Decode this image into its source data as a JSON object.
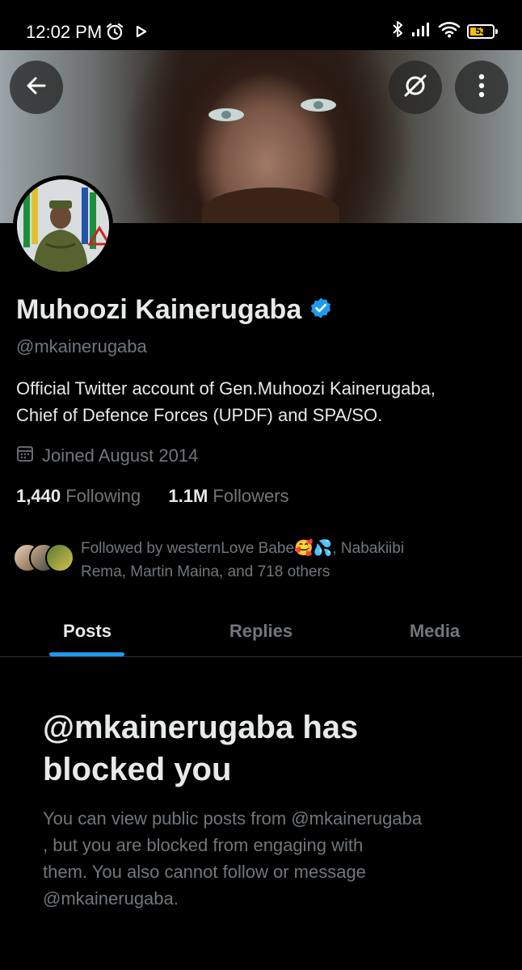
{
  "status_bar": {
    "time": "12:02 PM",
    "battery_level": "53",
    "icons": [
      "alarm-icon",
      "play-icon",
      "bluetooth-icon",
      "signal-icon",
      "wifi-icon",
      "battery-icon"
    ]
  },
  "header": {
    "back_icon": "arrow-left-icon",
    "grok_icon": "grok-icon",
    "more_icon": "more-vertical-icon"
  },
  "profile": {
    "name": "Muhoozi Kainerugaba",
    "verified": true,
    "handle": "@mkainerugaba",
    "bio_line1": "Official Twitter account of Gen.Muhoozi Kainerugaba,",
    "bio_line2": "Chief of Defence Forces (UPDF) and SPA/SO.",
    "joined": "Joined August 2014",
    "following_count": "1,440",
    "following_label": "Following",
    "followers_count": "1.1M",
    "followers_label": "Followers",
    "followed_by_line1": "Followed by westernLove Babe🥰💦, Nabakiibi",
    "followed_by_line2": "Rema, Martin Maina, and 718 others"
  },
  "tabs": [
    {
      "label": "Posts",
      "active": true
    },
    {
      "label": "Replies",
      "active": false
    },
    {
      "label": "Media",
      "active": false
    }
  ],
  "blocked": {
    "title_line1": "@mkainerugaba has",
    "title_line2": "blocked you",
    "body_line1": "You can view public posts from @mkainerugaba",
    "body_line2": ", but you are blocked from engaging with",
    "body_line3": "them. You also cannot follow or message",
    "body_line4": "@mkainerugaba."
  },
  "colors": {
    "background": "#000000",
    "primary_text": "#e7e9ea",
    "secondary_text": "#71767b",
    "accent": "#1d9bf0",
    "divider": "#2f3336"
  }
}
